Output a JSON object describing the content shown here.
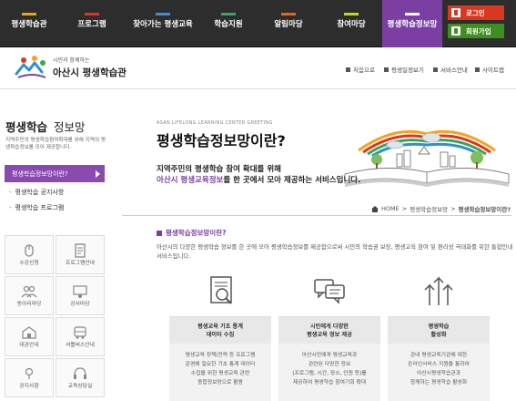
{
  "nav": {
    "items": [
      {
        "label": "평생학습관",
        "bar": "#e8a21f"
      },
      {
        "label": "프로그램",
        "bar": "#d9371f"
      },
      {
        "label": "찾아가는 평생교육",
        "bar": "#3b8fd4"
      },
      {
        "label": "학습지원",
        "bar": "#3aa655"
      },
      {
        "label": "알림마당",
        "bar": "#d96a1f"
      },
      {
        "label": "참여마당",
        "bar": "#c8d41f"
      },
      {
        "label": "평생학습정보망",
        "bar": "#ffffff"
      }
    ],
    "login": "로그인",
    "join": "회원가입",
    "colors": {
      "bg": "#2d2d2d",
      "active": "#7b3fa3",
      "login": "#d9371f",
      "join": "#3e8f1f"
    }
  },
  "header": {
    "logo_small": "시민과 함께하는",
    "logo_big": "아산시 평생학습관",
    "util": [
      "처음으로",
      "평생일정보기",
      "서비스안내",
      "사이트맵"
    ]
  },
  "sidebar": {
    "title_bold": "평생학습",
    "title_light": "정보망",
    "desc": "지역주민의 평생학습참여확대를 위해 지역의 평생학습정보를 모아 제공합니다.",
    "active_item": "평생학습정보망이란?",
    "items": [
      "평생학습 공지사항",
      "평생학습 프로그램"
    ],
    "icons": [
      {
        "label": "수강신청",
        "icon": "mouse-icon"
      },
      {
        "label": "프로그램안내",
        "icon": "document-icon"
      },
      {
        "label": "동아리마당",
        "icon": "people-icon"
      },
      {
        "label": "강사마당",
        "icon": "teacher-icon"
      },
      {
        "label": "대관안내",
        "icon": "building-icon"
      },
      {
        "label": "셔틀버스안내",
        "icon": "bus-icon"
      },
      {
        "label": "공지사항",
        "icon": "megaphone-icon"
      },
      {
        "label": "교육상담실",
        "icon": "headset-icon"
      }
    ]
  },
  "main": {
    "greeting": "ASAN LIFELONG LEARNING CENTER GREETING",
    "title": "평생학습정보망이란?",
    "lead1": "지역주민의 평생학습 참여 확대를 위해",
    "lead2_hl": "아산시 평생교육정보",
    "lead2_rest": "를 한 곳에서 모아 제공하는 서비스입니다.",
    "breadcrumb": [
      "HOME",
      "평생학습정보망",
      "평생학습정보망이란?"
    ],
    "section_title": "평생학습정보망이란?",
    "section_desc": "아산시의 다양한 평생학습 정보를 한 곳에 모아 평생학습정보를 제공함으로써 시민의 학습권 보장, 평생교육 참여 및 편리성 극대화를 위한 통합안내 서비스입니다.",
    "cards": [
      {
        "title1": "평생교육 기초 통계",
        "title2": "데이터 수집",
        "body": [
          "평생교육 정책/전략 등 프로그램",
          "운영에 필요한 기초 통계 데이터",
          "수집을 위한 평생교육 관련",
          "종합정보망으로 활용"
        ],
        "icon": "magnifier-document-icon"
      },
      {
        "title1": "시민에게 다양한",
        "title2": "평생교육 정보 제공",
        "body": [
          "아산시민에게 평생교육과",
          "관련된 다양한 정보",
          "(프로그램, 시간, 장소, 인원 등)를",
          "제공하여 평생학습 참여기회 확대"
        ],
        "icon": "chat-icon"
      },
      {
        "title1": "평생학습",
        "title2": "활성화",
        "body": [
          "관내 평생교육기관에 대한",
          "온라인서비스 지원을 통하여",
          "아산시평생학습관과",
          "함께하는 평생학습 활성화"
        ],
        "icon": "arrows-up-icon"
      }
    ]
  }
}
